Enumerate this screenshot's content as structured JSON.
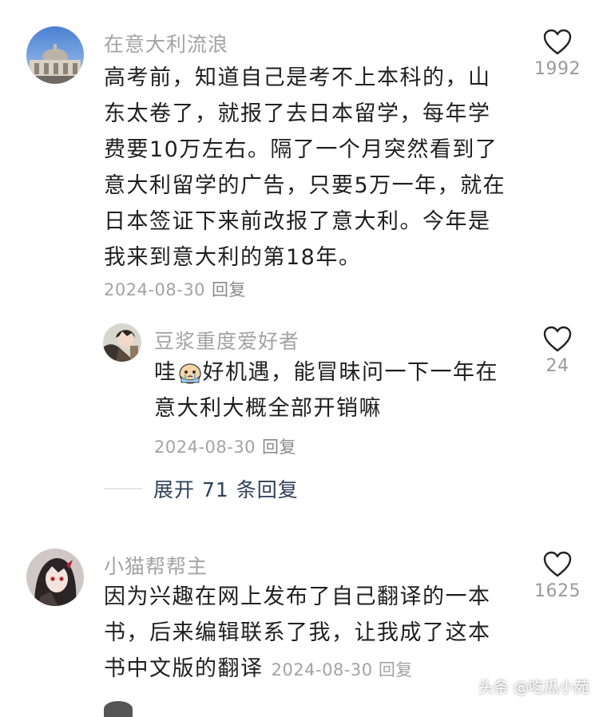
{
  "comments": [
    {
      "username": "在意大利流浪",
      "content": "高考前，知道自己是考不上本科的，山\n东太卷了，就报了去日本留学，每年学\n费要10万左右。隔了一个月突然看到了\n意大利留学的广告，只要5万一年，就在\n日本签证下来前改报了意大利。今年是\n我来到意大利的第18年。",
      "date": "2024-08-30",
      "reply_label": "回复",
      "likes": "1992",
      "avatar_icon": "cathedral-photo-avatar"
    },
    {
      "username": "豆浆重度爱好者",
      "content_before_emoji": "哇",
      "emoji_icon": "crying-face-emoji",
      "content_after_emoji": "好机遇，能冒昧问一下一年在\n意大利大概全部开销嘛",
      "date": "2024-08-30",
      "reply_label": "回复",
      "likes": "24",
      "avatar_icon": "anime-character-avatar"
    },
    {
      "username": "小猫帮帮主",
      "content": "因为兴趣在网上发布了自己翻译的一本\n书，后来编辑联系了我，让我成了这本\n书中文版的翻译",
      "date": "2024-08-30",
      "reply_label": "回复",
      "likes": "1625",
      "avatar_icon": "anime-girl-avatar"
    }
  ],
  "expand_replies": "展开 71 条回复",
  "watermark": "头条 @吃瓜小苑",
  "colors": {
    "username": "#a3a3a3",
    "content": "#1f1f1f",
    "expand_link": "#2f4058",
    "heart_outline": "#222222"
  }
}
